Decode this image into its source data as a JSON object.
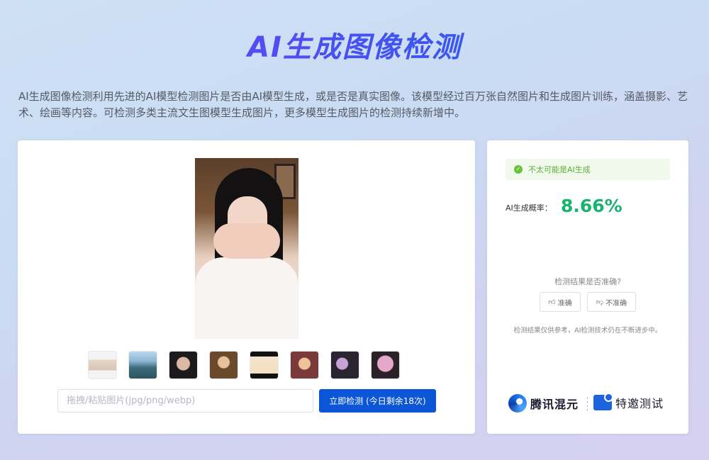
{
  "page": {
    "title": "AI生成图像检测",
    "description": "AI生成图像检测利用先进的AI模型检测图片是否由AI模型生成，或是否是真实图像。该模型经过百万张自然图片和生成图片训练，涵盖摄影、艺术、绘画等内容。可检测多类主流文生图模型生成图片，更多模型生成图片的检测持续新增中。"
  },
  "upload": {
    "placeholder": "拖拽/粘贴图片(jpg/png/webp)",
    "detect_button": "立即检测 (今日剩余18次)"
  },
  "samples": [
    {
      "name": "sample-1"
    },
    {
      "name": "sample-2"
    },
    {
      "name": "sample-3"
    },
    {
      "name": "sample-4"
    },
    {
      "name": "sample-5"
    },
    {
      "name": "sample-6"
    },
    {
      "name": "sample-7"
    },
    {
      "name": "sample-8"
    }
  ],
  "result": {
    "verdict": "不太可能是AI生成",
    "probability_label": "AI生成概率：",
    "probability_value": "8.66%",
    "feedback_question": "检测结果是否准确?",
    "accurate_label": "准确",
    "inaccurate_label": "不准确",
    "disclaimer": "检测结果仅供参考，AI检测技术仍在不断进步中。"
  },
  "brands": {
    "hunyuan": "腾讯混元",
    "invite": "特邀测试"
  },
  "colors": {
    "accent_blue": "#0a56d6",
    "success_green": "#19b36f",
    "title_gradient_start": "#7a3cf0",
    "title_gradient_end": "#1e63e6"
  }
}
